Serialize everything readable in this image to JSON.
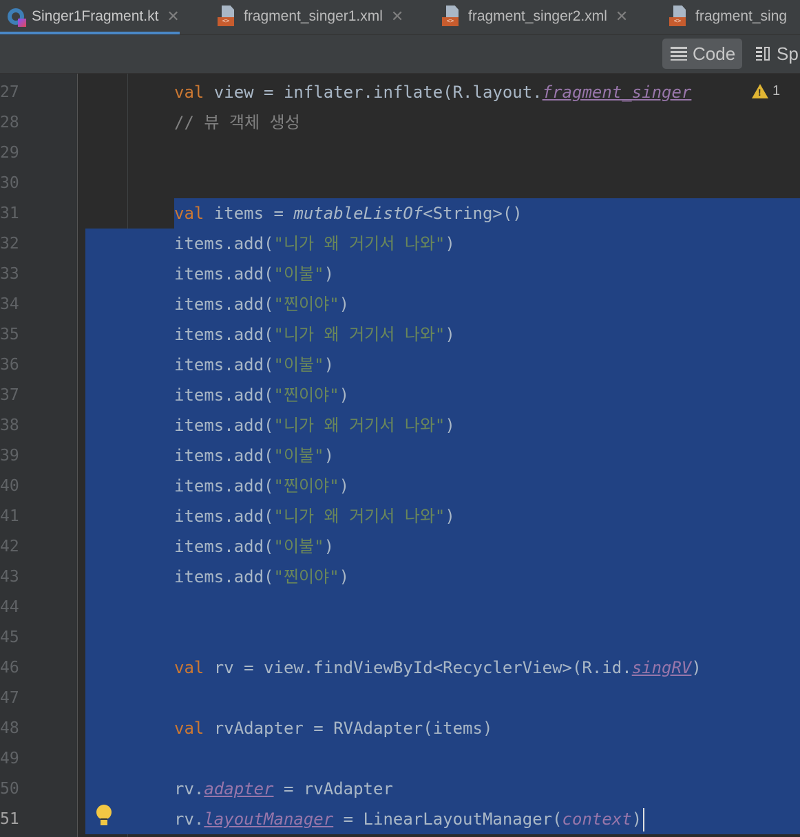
{
  "tabs": [
    {
      "label": "Singer1Fragment.kt",
      "icon": "kotlin-file-icon",
      "active": true
    },
    {
      "label": "fragment_singer1.xml",
      "icon": "xml-file-icon",
      "active": false
    },
    {
      "label": "fragment_singer2.xml",
      "icon": "xml-file-icon",
      "active": false
    },
    {
      "label": "fragment_sing",
      "icon": "xml-file-icon",
      "active": false
    }
  ],
  "xml_badge": "<>",
  "close_glyph": "✕",
  "toolbar": {
    "code_label": "Code",
    "split_label": "Sp"
  },
  "warning": {
    "icon": "warning-icon",
    "count": "1"
  },
  "lines": {
    "l27": {
      "no": "27",
      "kw": "val",
      "a": " view = inflater.inflate(R.layout.",
      "prop": "fragment_singer"
    },
    "l28": {
      "no": "28",
      "comment": "// 뷰 객체 생성"
    },
    "l29": {
      "no": "29"
    },
    "l30": {
      "no": "30"
    },
    "l31": {
      "no": "31",
      "kw": "val",
      "a": " items = ",
      "fn": "mutableListOf",
      "b": "<String>()"
    },
    "l32": {
      "no": "32",
      "a": "items.add(",
      "s": "\"니가 왜 거기서 나와\"",
      "b": ")"
    },
    "l33": {
      "no": "33",
      "a": "items.add(",
      "s": "\"이불\"",
      "b": ")"
    },
    "l34": {
      "no": "34",
      "a": "items.add(",
      "s": "\"찐이야\"",
      "b": ")"
    },
    "l35": {
      "no": "35",
      "a": "items.add(",
      "s": "\"니가 왜 거기서 나와\"",
      "b": ")"
    },
    "l36": {
      "no": "36",
      "a": "items.add(",
      "s": "\"이불\"",
      "b": ")"
    },
    "l37": {
      "no": "37",
      "a": "items.add(",
      "s": "\"찐이야\"",
      "b": ")"
    },
    "l38": {
      "no": "38",
      "a": "items.add(",
      "s": "\"니가 왜 거기서 나와\"",
      "b": ")"
    },
    "l39": {
      "no": "39",
      "a": "items.add(",
      "s": "\"이불\"",
      "b": ")"
    },
    "l40": {
      "no": "40",
      "a": "items.add(",
      "s": "\"찐이야\"",
      "b": ")"
    },
    "l41": {
      "no": "41",
      "a": "items.add(",
      "s": "\"니가 왜 거기서 나와\"",
      "b": ")"
    },
    "l42": {
      "no": "42",
      "a": "items.add(",
      "s": "\"이불\"",
      "b": ")"
    },
    "l43": {
      "no": "43",
      "a": "items.add(",
      "s": "\"찐이야\"",
      "b": ")"
    },
    "l44": {
      "no": "44"
    },
    "l45": {
      "no": "45"
    },
    "l46": {
      "no": "46",
      "kw": "val",
      "a": " rv = view.findViewById<RecyclerView>(R.id.",
      "prop": "singRV",
      "b": ")"
    },
    "l47": {
      "no": "47"
    },
    "l48": {
      "no": "48",
      "kw": "val",
      "a": " rvAdapter = RVAdapter(items)"
    },
    "l49": {
      "no": "49"
    },
    "l50": {
      "no": "50",
      "a": "rv.",
      "prop": "adapter",
      "b": " = rvAdapter"
    },
    "l51": {
      "no": "51",
      "a": "rv.",
      "prop": "layoutManager",
      "b": " = LinearLayoutManager(",
      "param": "context",
      "c": ")"
    }
  },
  "colors": {
    "keyword": "#cc7832",
    "string": "#6a8759",
    "property": "#9876aa",
    "selection": "#214283",
    "comment": "#808080"
  }
}
